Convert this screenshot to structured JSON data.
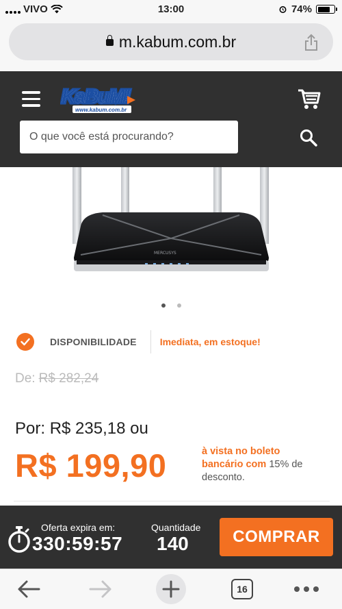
{
  "status_bar": {
    "carrier": "VIVO",
    "time": "13:00",
    "battery": "74%",
    "battery_level": 0.74
  },
  "browser": {
    "url": "m.kabum.com.br"
  },
  "header": {
    "logo_text": "KaBuM!",
    "logo_subtext": "www.kabum.com.br",
    "search_placeholder": "O que você está procurando?"
  },
  "gallery": {
    "image_count": 2,
    "active_index": 0
  },
  "availability": {
    "label": "DISPONIBILIDADE",
    "value": "Imediata, em estoque!"
  },
  "pricing": {
    "old_label": "De:",
    "old_price": "R$ 282,24",
    "por_label": "Por:",
    "por_price": "R$ 235,18",
    "por_suffix": "ou",
    "cash_price": "R$ 199,90",
    "boleto_highlight": "à vista no boleto bancário com",
    "boleto_rest": "15% de desconto."
  },
  "offer": {
    "expires_label": "Oferta expira em:",
    "timer": "330:59:57",
    "quantity_label": "Quantidade",
    "quantity": "140",
    "buy_label": "COMPRAR"
  },
  "toolbar": {
    "tab_count": "16"
  },
  "colors": {
    "accent": "#f37021",
    "header_bg": "#303030",
    "logo_blue": "#1c4fa3"
  }
}
